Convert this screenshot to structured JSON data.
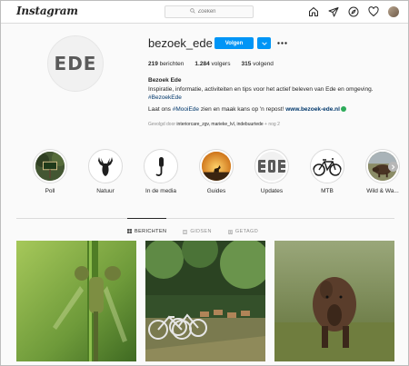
{
  "nav": {
    "logo": "Instagram",
    "search_placeholder": "Zoeken",
    "icons": [
      "home-icon",
      "direct-icon",
      "explore-icon",
      "heart-icon",
      "avatar"
    ]
  },
  "profile": {
    "username": "bezoek_ede",
    "avatar_text": "EDE",
    "follow_label": "Volgen",
    "stats": {
      "posts_count": "219",
      "posts_label": "berichten",
      "followers_count": "1.284",
      "followers_label": "volgers",
      "following_count": "315",
      "following_label": "volgend"
    },
    "bio": {
      "name": "Bezoek Ede",
      "line1": "Inspiratie, informatie, activiteiten en tips voor het actief beleven van Ede en omgeving.",
      "hashtag": "#BezoekEde",
      "line3_pre": "Laat ons ",
      "line3_tag": "#MooiEde",
      "line3_post": " zien en maak kans op 'n repost! ",
      "website": "www.bezoek-ede.nl"
    },
    "followed_by_prefix": "Gevolgd door ",
    "followed_by_names": "interiorcare_zgv, marieke_lvl, indebuurtede",
    "followed_by_suffix": " + nog 2"
  },
  "highlights": [
    {
      "label": "Poll",
      "icon": "sign-icon"
    },
    {
      "label": "Natuur",
      "icon": "deer-icon"
    },
    {
      "label": "In de media",
      "icon": "microphone-icon"
    },
    {
      "label": "Guides",
      "icon": "sunset-deer-icon"
    },
    {
      "label": "Updates",
      "icon": "ede-logo-icon"
    },
    {
      "label": "MTB",
      "icon": "bicycle-icon"
    },
    {
      "label": "Wild & Wa...",
      "icon": "wild-boar-icon"
    }
  ],
  "tabs": [
    {
      "label": "BERICHTEN",
      "active": true
    },
    {
      "label": "GIDSEN",
      "active": false
    },
    {
      "label": "GETAGD",
      "active": false
    }
  ],
  "posts": [
    {
      "subject": "dragonfly",
      "color": "#6e9a3a"
    },
    {
      "subject": "bicycles-and-deer",
      "color": "#3f5a2c"
    },
    {
      "subject": "wild-boar",
      "color": "#7b8a4c"
    }
  ],
  "colors": {
    "accent": "#0095f6",
    "link": "#00376b",
    "verified": "#2eab5a"
  }
}
